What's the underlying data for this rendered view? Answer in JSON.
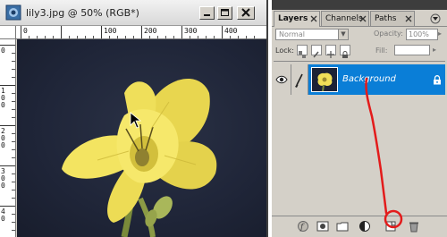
{
  "doc_window": {
    "title": "lily3.jpg @ 50% (RGB*)",
    "ruler_top_numbers": [
      "0",
      "100",
      "200",
      "300",
      "400"
    ],
    "ruler_left_numbers": [
      "0",
      "1 0 0",
      "2 0 0",
      "3 0 0",
      "4 0"
    ]
  },
  "layers_palette": {
    "tabs": [
      {
        "label": "Layers"
      },
      {
        "label": "Channels"
      },
      {
        "label": "Paths"
      }
    ],
    "blend_mode": "Normal",
    "opacity_label": "Opacity:",
    "opacity_value": "100%",
    "lock_label": "Lock:",
    "fill_label": "Fill:",
    "layer": {
      "name": "Background",
      "visible": true,
      "selected": true
    },
    "bottom_buttons": [
      "layer-style-icon",
      "layer-mask-icon",
      "new-set-icon",
      "adjustment-layer-icon",
      "new-layer-icon",
      "delete-layer-icon"
    ]
  },
  "colors": {
    "selection_blue": "#0a7ed7",
    "annotation_red": "#e31b1b",
    "canvas_background": "#1f2538",
    "flower_yellow": "#f2e25a"
  }
}
